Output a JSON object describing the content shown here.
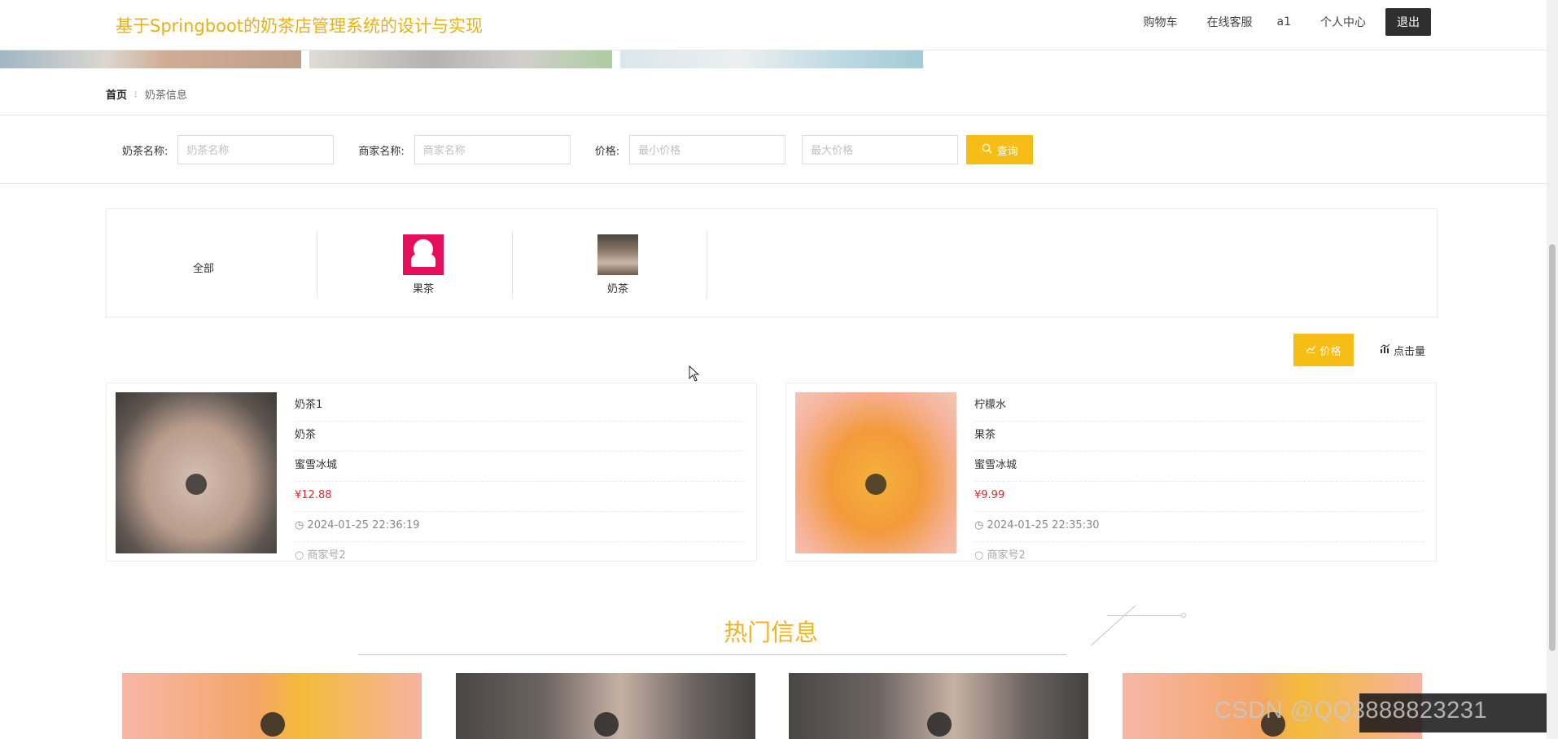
{
  "header": {
    "site_title": "基于Springboot的奶茶店管理系统的设计与实现",
    "nav": {
      "cart": "购物车",
      "service": "在线客服",
      "user": "a1",
      "profile": "个人中心",
      "logout": "退出"
    }
  },
  "breadcrumb": {
    "home": "首页",
    "current": "奶茶信息"
  },
  "search": {
    "tea_name_label": "奶茶名称:",
    "tea_name_placeholder": "奶茶名称",
    "merchant_label": "商家名称:",
    "merchant_placeholder": "商家名称",
    "price_label": "价格:",
    "min_price_placeholder": "最小价格",
    "max_price_placeholder": "最大价格",
    "query_button": "查询"
  },
  "categories": [
    {
      "label": "全部",
      "icon": "none"
    },
    {
      "label": "果茶",
      "icon": "fruit-tea-thumbnail"
    },
    {
      "label": "奶茶",
      "icon": "milk-tea-thumbnail"
    }
  ],
  "sort": {
    "price": "价格",
    "clicks": "点击量"
  },
  "products": [
    {
      "name": "奶茶1",
      "category": "奶茶",
      "merchant": "蜜雪冰城",
      "price": "¥12.88",
      "time": "2024-01-25 22:36:19",
      "extra": "商家号2"
    },
    {
      "name": "柠檬水",
      "category": "果茶",
      "merchant": "蜜雪冰城",
      "price": "¥9.99",
      "time": "2024-01-25 22:35:30",
      "extra": "商家号2"
    }
  ],
  "hot": {
    "title": "热门信息"
  },
  "watermark": "CSDN @QQ3888823231",
  "colors": {
    "accent": "#f6bd16",
    "title": "#e9b10f",
    "price": "#e02b2b"
  }
}
